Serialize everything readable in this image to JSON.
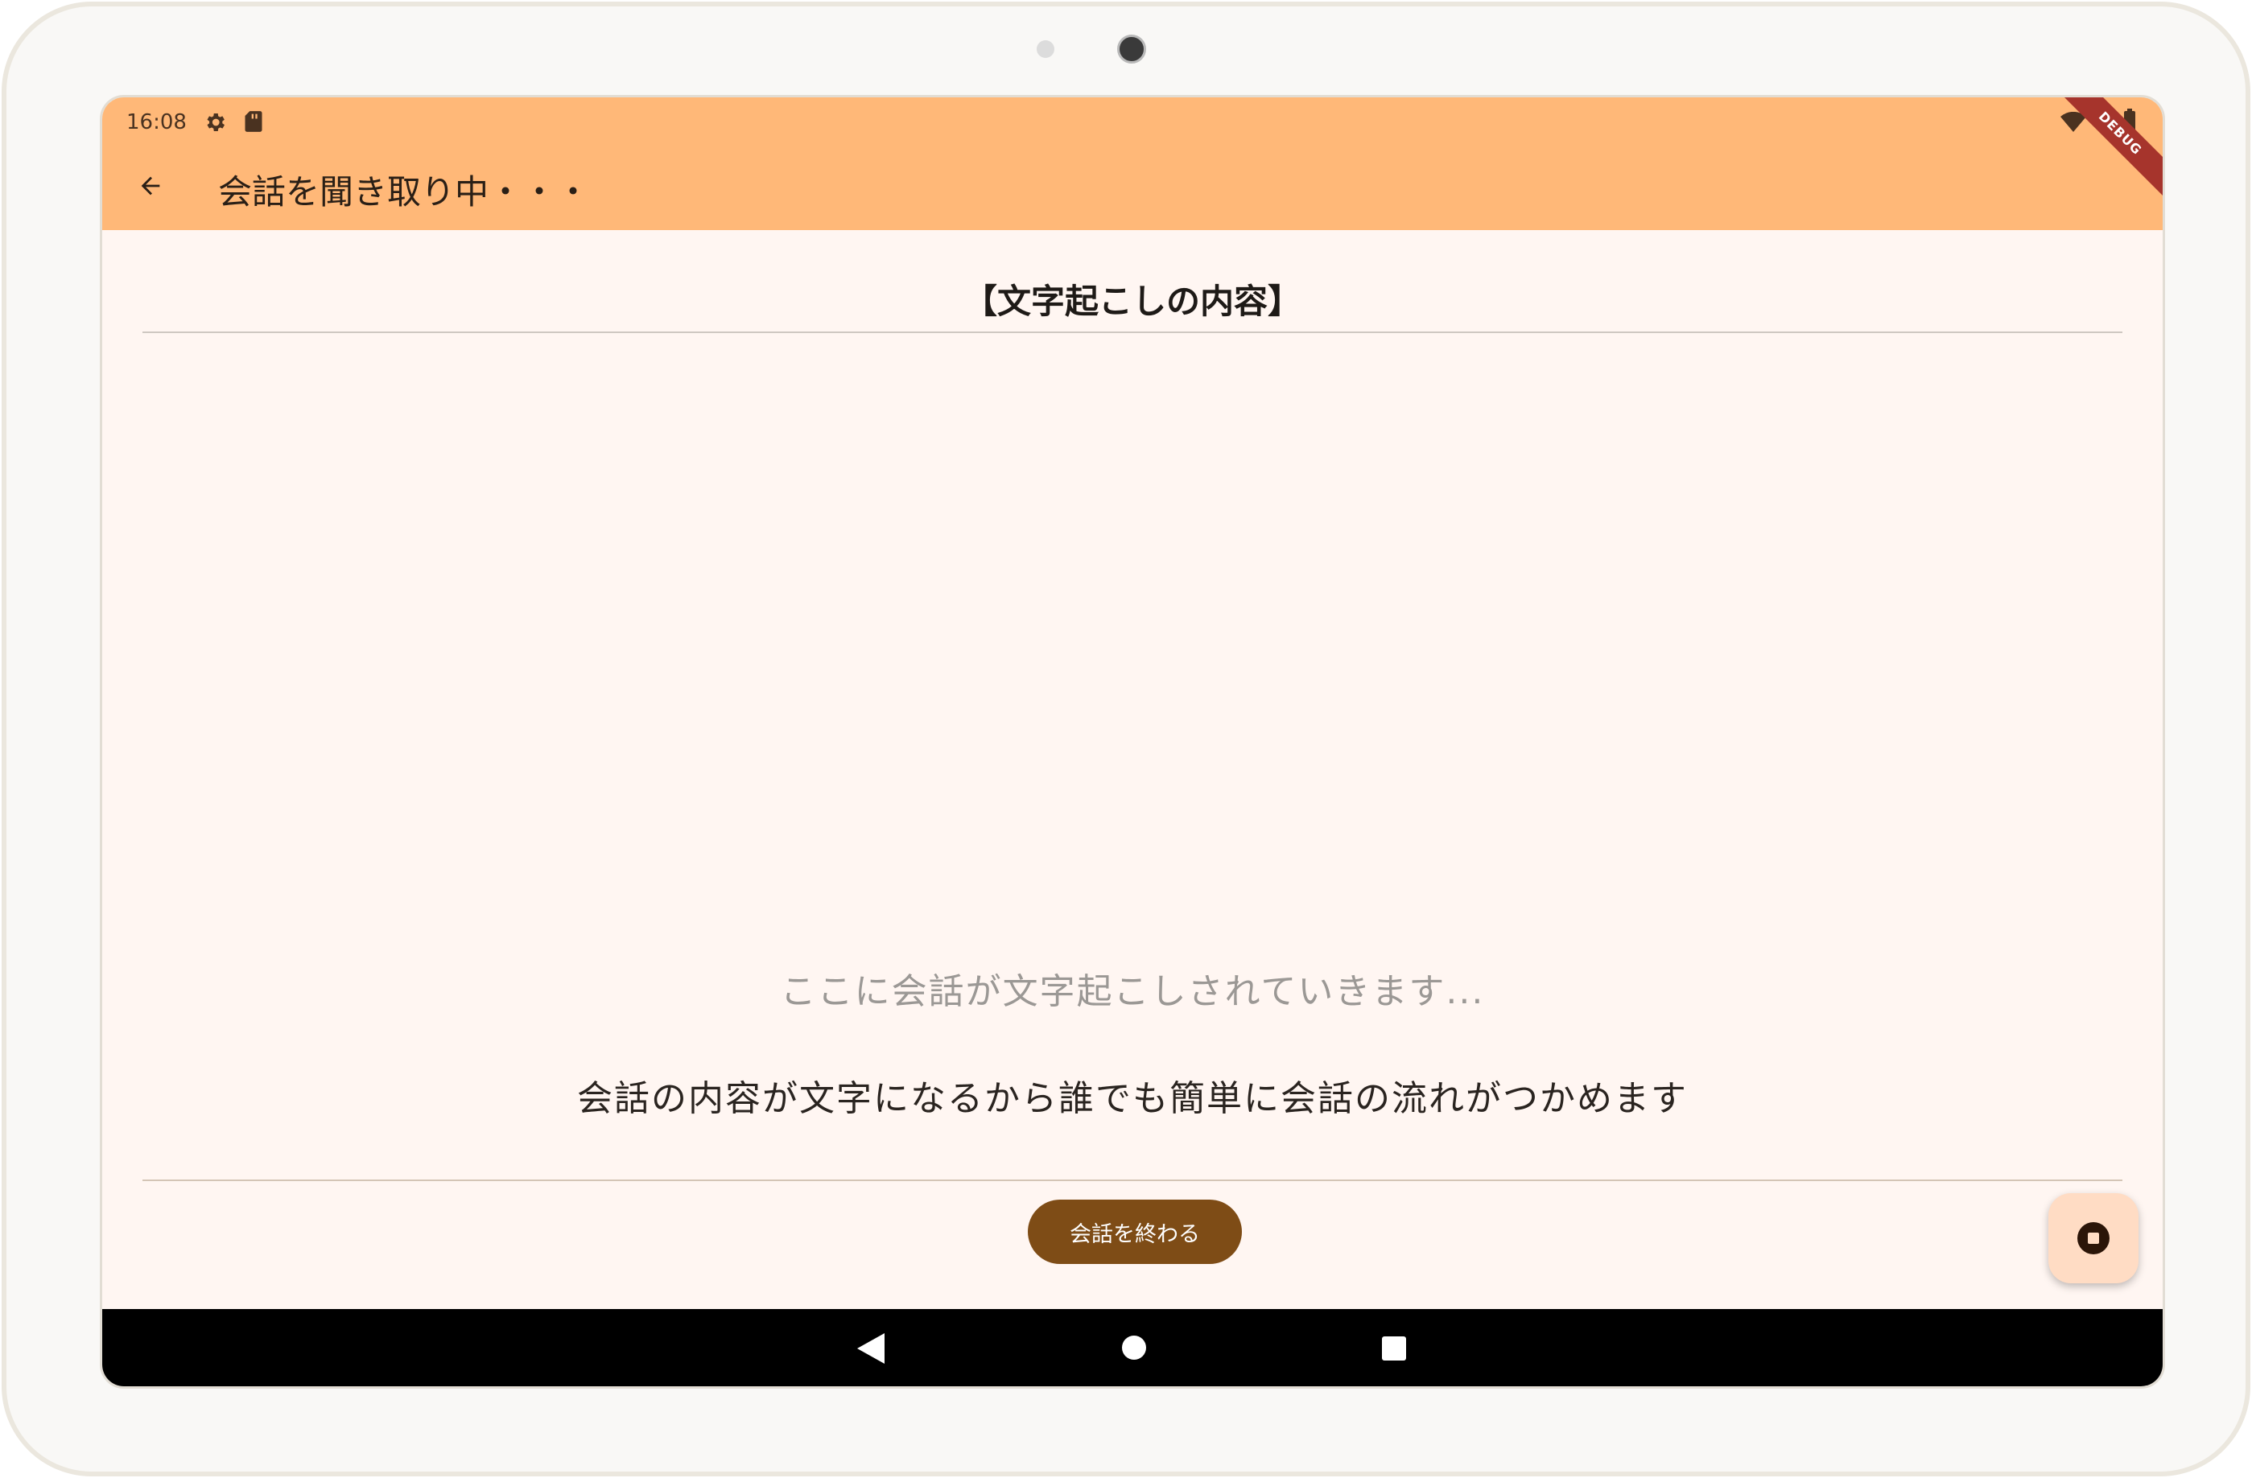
{
  "status_bar": {
    "time": "16:08",
    "icons": [
      "gear-icon",
      "sd-card-icon",
      "wifi-icon",
      "battery-icon"
    ]
  },
  "debug_banner": "DEBUG",
  "app_bar": {
    "title": "会話を聞き取り中・・・",
    "back_icon": "arrow-back-icon"
  },
  "main": {
    "section_title": "【文字起こしの内容】",
    "placeholder": "ここに会話が文字起こしされていきます...",
    "info": "会話の内容が文字になるから誰でも簡単に会話の流れがつかめます",
    "end_button_label": "会話を終わる",
    "fab_icon": "stop-icon"
  },
  "nav_bar": {
    "icons": [
      "nav-back-icon",
      "nav-home-icon",
      "nav-recents-icon"
    ]
  },
  "colors": {
    "app_bar": "#ffb878",
    "background": "#fff6f2",
    "end_button": "#7e4c16",
    "fab": "#ffdcc4",
    "debug_ribbon": "#a6342c"
  }
}
